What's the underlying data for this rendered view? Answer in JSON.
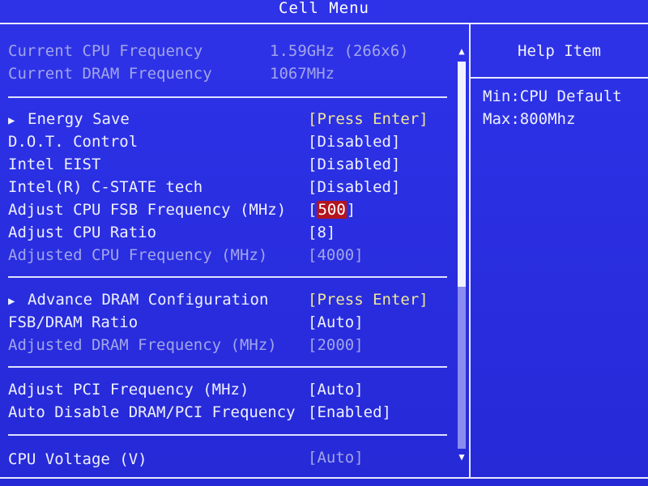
{
  "title": "Cell Menu",
  "info": [
    {
      "label": "Current CPU Frequency",
      "value": "1.59GHz (266x6)"
    },
    {
      "label": "Current DRAM Frequency",
      "value": "1067MHz"
    }
  ],
  "items": [
    {
      "label": "Energy Save",
      "value": "[Press Enter]",
      "submenu": true
    },
    {
      "label": "D.O.T. Control",
      "value": "[Disabled]"
    },
    {
      "label": "Intel EIST",
      "value": "[Disabled]"
    },
    {
      "label": "Intel(R) C-STATE tech",
      "value": "[Disabled]"
    },
    {
      "label": "Adjust CPU FSB Frequency (MHz)",
      "value_open": "[",
      "value_selected": "500",
      "value_close": "]"
    },
    {
      "label": "Adjust CPU Ratio",
      "value": "[8]"
    },
    {
      "label": "Adjusted CPU Frequency (MHz)",
      "value": "[4000]",
      "disabled": true
    },
    {
      "label": "Advance DRAM Configuration",
      "value": "[Press Enter]",
      "submenu": true
    },
    {
      "label": "FSB/DRAM Ratio",
      "value": "[Auto]"
    },
    {
      "label": "Adjusted DRAM Frequency (MHz)",
      "value": "[2000]",
      "disabled": true
    },
    {
      "label": "Adjust PCI Frequency (MHz)",
      "value": "[Auto]"
    },
    {
      "label": "Auto Disable DRAM/PCI Frequency",
      "value": "[Enabled]"
    },
    {
      "label": "CPU Voltage (V)",
      "value": "[Auto]"
    }
  ],
  "help": {
    "title": "Help Item",
    "lines": [
      "Min:CPU Default",
      "Max:800Mhz"
    ]
  },
  "icons": {
    "submenu": "triangle-right",
    "scroll_up": "triangle-up",
    "scroll_down": "triangle-down"
  },
  "colors": {
    "background": "#2b2ee0",
    "text": "#eef0ff",
    "disabled_text": "#a2a5ea",
    "submenu_value": "#f0e69a",
    "selection": "#b4141e"
  }
}
